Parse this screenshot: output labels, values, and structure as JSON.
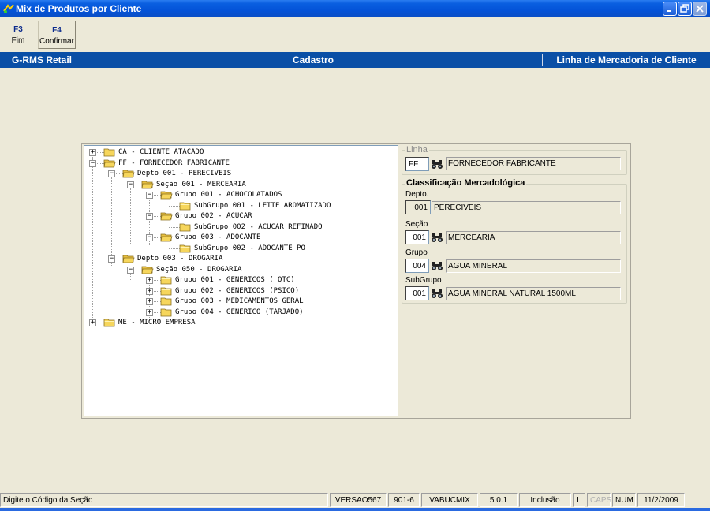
{
  "window": {
    "title": "Mix de Produtos por Cliente"
  },
  "toolbar": {
    "f3_key": "F3",
    "f3_label": "Fim",
    "f4_key": "F4",
    "f4_label": "Confirmar"
  },
  "header": {
    "left": "G-RMS Retail",
    "center": "Cadastro",
    "right": "Linha de Mercadoria de Cliente"
  },
  "tree": {
    "items": [
      {
        "label": "CA - CLIENTE ATACADO",
        "expander": "+"
      },
      {
        "label": "FF - FORNECEDOR FABRICANTE",
        "expander": "−"
      },
      {
        "label": "Depto 001 - PERECIVEIS",
        "expander": "−"
      },
      {
        "label": "Seção 001 - MERCEARIA",
        "expander": "−"
      },
      {
        "label": "Grupo 001 - ACHOCOLATADOS",
        "expander": "−"
      },
      {
        "label": "SubGrupo 001 - LEITE AROMATIZADO",
        "expander": ""
      },
      {
        "label": "Grupo 002 - ACUCAR",
        "expander": "−"
      },
      {
        "label": "SubGrupo 002 - ACUCAR REFINADO",
        "expander": ""
      },
      {
        "label": "Grupo 003 - ADOCANTE",
        "expander": "−"
      },
      {
        "label": "SubGrupo 002 - ADOCANTE PO",
        "expander": ""
      },
      {
        "label": "Depto 003 - DROGARIA",
        "expander": "−"
      },
      {
        "label": "Seção 050 - DROGARIA",
        "expander": "−"
      },
      {
        "label": "Grupo 001 - GENERICOS ( OTC)",
        "expander": "+"
      },
      {
        "label": "Grupo 002 - GENERICOS (PSICO)",
        "expander": "+"
      },
      {
        "label": "Grupo 003 - MEDICAMENTOS GERAL",
        "expander": "+"
      },
      {
        "label": "Grupo 004 - GENERICO (TARJADO)",
        "expander": "+"
      },
      {
        "label": "ME - MICRO EMPRESA",
        "expander": "+"
      }
    ]
  },
  "linha": {
    "group_title": "Linha",
    "code": "FF",
    "description": "FORNECEDOR FABRICANTE"
  },
  "classificacao": {
    "group_title": "Classificação Mercadológica",
    "depto_label": "Depto.",
    "depto_code": "001",
    "depto_desc": "PERECIVEIS",
    "secao_label": "Seção",
    "secao_code": "001",
    "secao_desc": "MERCEARIA",
    "grupo_label": "Grupo",
    "grupo_code": "004",
    "grupo_desc": "AGUA MINERAL",
    "subgrupo_label": "SubGrupo",
    "subgrupo_code": "001",
    "subgrupo_desc": "AGUA MINERAL NATURAL 1500ML"
  },
  "statusbar": {
    "message": "Digite o Código da Seção",
    "version": "VERSAO567",
    "code": "901-6",
    "program": "VABUCMIX",
    "release": "5.0.1",
    "mode": "Inclusão",
    "l": "L",
    "caps": "CAPS",
    "num": "NUM",
    "date": "11/2/2009"
  },
  "colors": {
    "header_blue": "#0a4fa6",
    "title_blue": "#0453d8",
    "folder_yellow": "#f6d65c"
  }
}
